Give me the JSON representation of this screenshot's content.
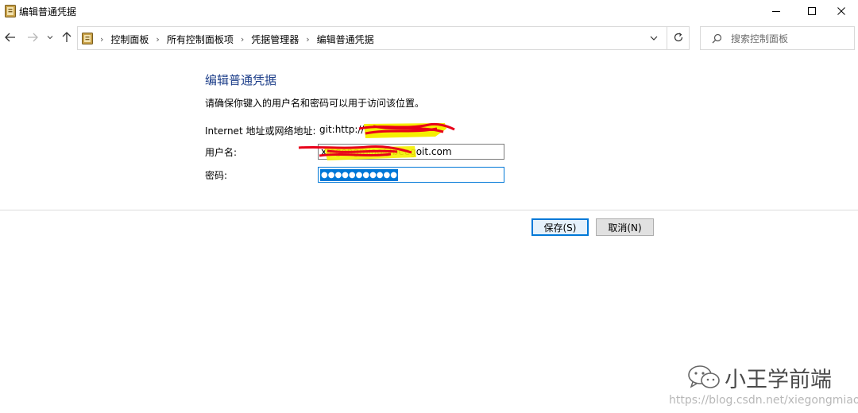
{
  "window": {
    "title": "编辑普通凭据",
    "icon": "control-panel-icon",
    "controls": [
      "minimize-icon",
      "maximize-icon",
      "close-icon"
    ]
  },
  "nav": {
    "buttons": [
      "back-arrow-icon",
      "forward-arrow-icon",
      "recent-dropdown-icon",
      "up-arrow-icon"
    ],
    "breadcrumb": [
      "控制面板",
      "所有控制面板项",
      "凭据管理器",
      "编辑普通凭据"
    ],
    "refresh_icon": "refresh-icon",
    "search": {
      "placeholder": "搜索控制面板",
      "value": ""
    }
  },
  "main": {
    "heading": "编辑普通凭据",
    "description": "请确保你键入的用户名和密码可以用于访问该位置。",
    "fields": {
      "address": {
        "label": "Internet 地址或网络地址:",
        "value": "git:http://2"
      },
      "username": {
        "label": "用户名:",
        "value": "xiegongmiao@beegoit.com"
      },
      "password": {
        "label": "密码:",
        "masked": "●●●●●●●●●●●"
      }
    },
    "buttons": {
      "save": "保存(S)",
      "cancel": "取消(N)"
    }
  },
  "watermark": {
    "brand": "小王学前端",
    "url": "https://blog.csdn.net/xiegongmiao"
  },
  "colors": {
    "heading": "#1e3f8a",
    "accent": "#0078d7",
    "redaction_red": "#e8001a",
    "highlight_yellow": "#f5ef00"
  }
}
